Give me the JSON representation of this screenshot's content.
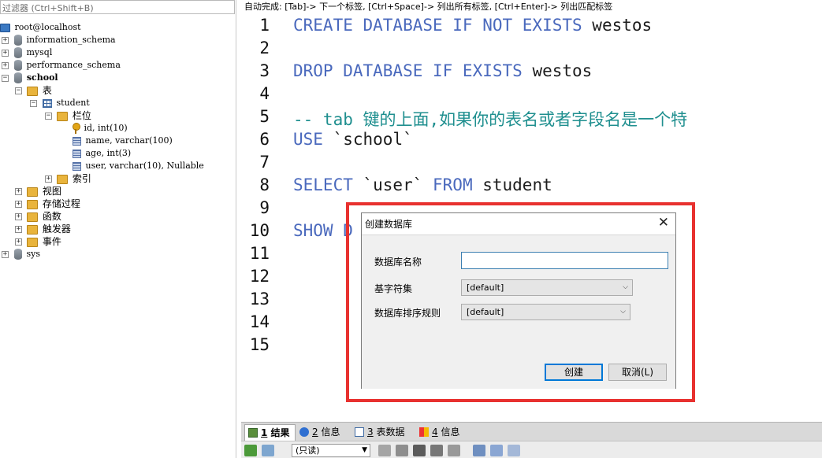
{
  "filter_placeholder": "过滤器 (Ctrl+Shift+B)",
  "tree": {
    "root": "root@localhost",
    "databases": [
      "information_schema",
      "mysql",
      "performance_schema",
      "school",
      "sys"
    ],
    "tables_folder": "表",
    "table": "student",
    "columns_folder": "栏位",
    "columns": [
      "id, int(10)",
      "name, varchar(100)",
      "age, int(3)",
      "user, varchar(10), Nullable"
    ],
    "index_folder": "索引",
    "other_folders": [
      "视图",
      "存储过程",
      "函数",
      "触发器",
      "事件"
    ]
  },
  "autocomplete_hint": "自动完成: [Tab]-> 下一个标签, [Ctrl+Space]-> 列出所有标签, [Ctrl+Enter]-> 列出匹配标签",
  "editor": {
    "line_numbers": [
      "1",
      "2",
      "3",
      "4",
      "5",
      "6",
      "7",
      "8",
      "9",
      "10",
      "11",
      "12",
      "13",
      "14",
      "15"
    ],
    "l1_kw": "CREATE DATABASE IF NOT EXISTS",
    "l1_rest": " westos",
    "l3_kw": "DROP DATABASE IF EXISTS",
    "l3_rest": " westos",
    "l5_comment": "-- tab 键的上面,如果你的表名或者字段名是一个特",
    "l6_kw": "USE",
    "l6_rest": " `school`",
    "l8_kw1": "SELECT",
    "l8_mid": " `user` ",
    "l8_kw2": "FROM",
    "l8_rest": " student",
    "l10_kw": "SHOW D"
  },
  "tabs": [
    {
      "num": "1",
      "label": " 结果"
    },
    {
      "num": "2",
      "label": " 信息"
    },
    {
      "num": "3",
      "label": " 表数据"
    },
    {
      "num": "4",
      "label": " 信息"
    }
  ],
  "toolbar": {
    "readonly_select": "(只读)"
  },
  "dialog": {
    "title": "创建数据库",
    "close": "✕",
    "label_name": "数据库名称",
    "label_charset": "基字符集",
    "label_collation": "数据库排序规则",
    "name_value": "",
    "charset_value": "[default]",
    "collation_value": "[default]",
    "create_btn": "创建",
    "cancel_btn": "取消(L)"
  },
  "colors": {
    "keyword": "#4a69bd",
    "comment": "#1f8f8f",
    "highlight": "#e8312f"
  }
}
